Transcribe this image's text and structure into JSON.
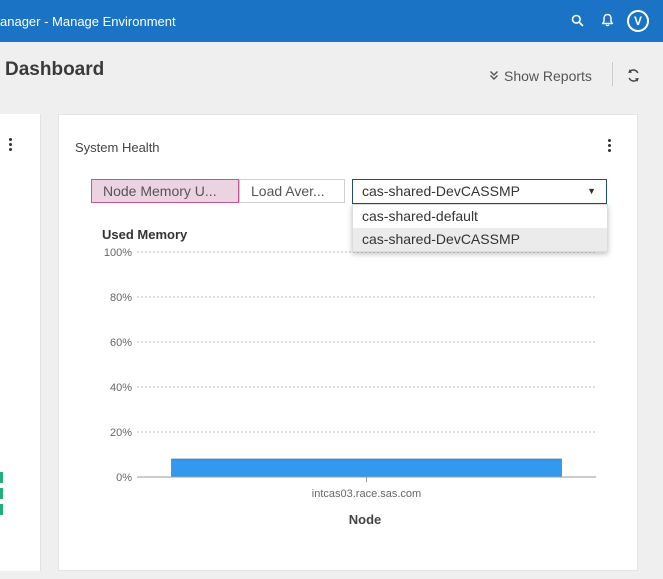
{
  "topbar": {
    "title": "anager - Manage Environment",
    "icons": [
      "search-icon",
      "bell-icon"
    ],
    "avatar_letter": "V",
    "bg_color": "#1a73c4"
  },
  "header": {
    "title": "Dashboard",
    "show_reports_label": "Show Reports"
  },
  "card": {
    "title": "System Health",
    "tabs": [
      {
        "label": "Node Memory U...",
        "active": true
      },
      {
        "label": "Load Aver...",
        "active": false
      }
    ],
    "select": {
      "value": "cas-shared-DevCASSMP",
      "options": [
        "cas-shared-default",
        "cas-shared-DevCASSMP"
      ],
      "selected_index": 1
    }
  },
  "chart_data": {
    "type": "bar",
    "title": "Used Memory",
    "xlabel": "Node",
    "ylabel": "",
    "categories": [
      "intcas03.race.sas.com"
    ],
    "values": [
      8
    ],
    "ylim": [
      0,
      100
    ],
    "yticks": [
      "0%",
      "20%",
      "40%",
      "60%",
      "80%",
      "100%"
    ],
    "grid": true,
    "bar_color": "#3399ee"
  }
}
